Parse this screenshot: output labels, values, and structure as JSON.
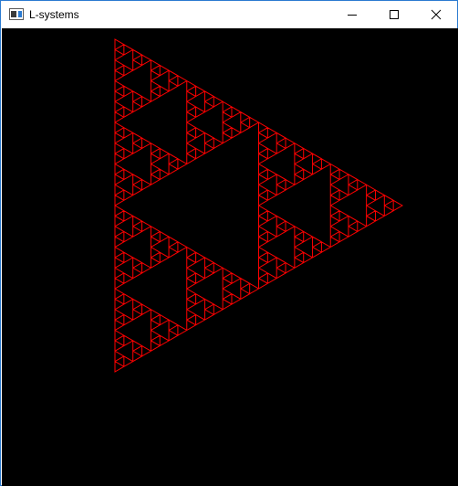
{
  "window": {
    "title": "L-systems",
    "app_icon": "window-app-icon",
    "controls": {
      "minimize_icon": "minimize-icon",
      "maximize_icon": "maximize-icon",
      "close_icon": "close-icon"
    }
  },
  "canvas": {
    "background": "#000000",
    "stroke_color": "#ff0000",
    "fractal": "sierpinski-triangle",
    "iterations": 5
  }
}
